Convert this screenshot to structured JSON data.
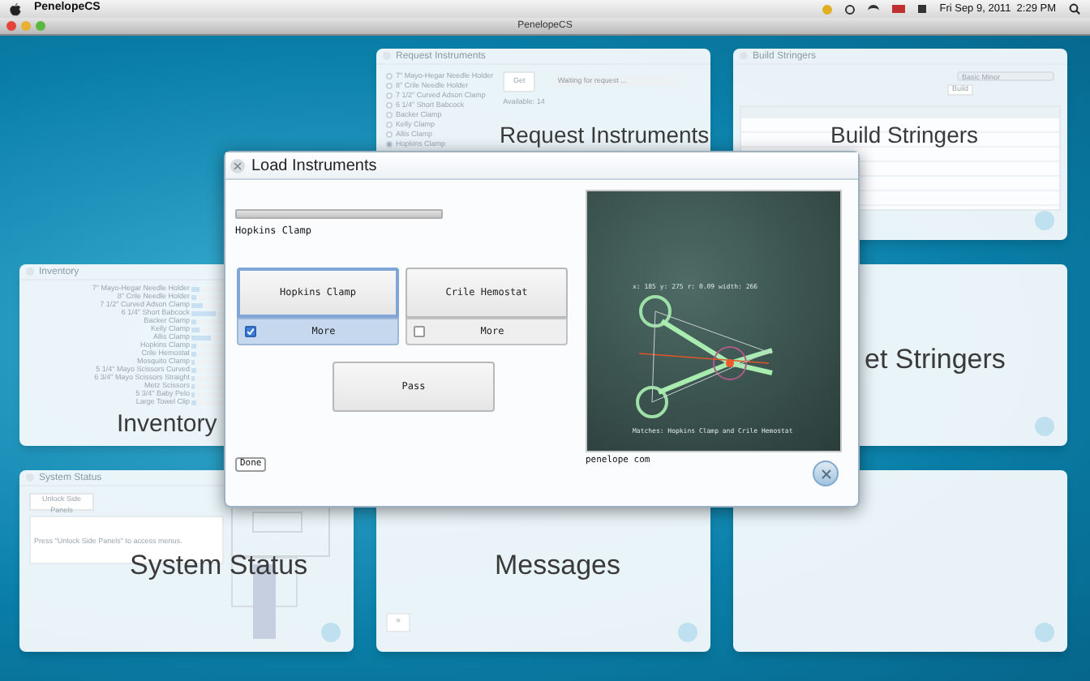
{
  "menu_bar": {
    "app_name": "PenelopeCS",
    "clock": "Fri Sep 9, 2011  2:29 PM"
  },
  "window": {
    "title": "PenelopeCS"
  },
  "panels": [
    {
      "kind": "empty"
    },
    {
      "kind": "request",
      "title": "Request Instruments",
      "label": "Request Instruments",
      "get_button": "Get",
      "available": "Available: 14",
      "placeholder": "Waiting for request ...",
      "items": [
        {
          "label": "7\" Mayo-Hegar Needle Holder",
          "selected": false
        },
        {
          "label": "8\" Crile Needle Holder",
          "selected": false
        },
        {
          "label": "7 1/2\" Curved Adson Clamp",
          "selected": false
        },
        {
          "label": "6 1/4\" Short Babcock",
          "selected": false
        },
        {
          "label": "Backer Clamp",
          "selected": false
        },
        {
          "label": "Kelly Clamp",
          "selected": false
        },
        {
          "label": "Allis Clamp",
          "selected": false
        },
        {
          "label": "Hopkins Clamp",
          "selected": true
        }
      ]
    },
    {
      "kind": "stringers",
      "title": "Build Stringers",
      "label": "Build Stringers",
      "select": "Basic Minor",
      "build_button": "Build"
    },
    {
      "kind": "inventory",
      "title": "Inventory",
      "label": "Inventory",
      "items": [
        {
          "label": "7\" Mayo-Hegar Needle Holder",
          "level": 0.15
        },
        {
          "label": "8\" Crile Needle Holder",
          "level": 0.1
        },
        {
          "label": "7 1/2\" Curved Adson Clamp",
          "level": 0.2
        },
        {
          "label": "6 1/4\" Short Babcock",
          "level": 0.45
        },
        {
          "label": "Backer Clamp",
          "level": 0.1
        },
        {
          "label": "Kelly Clamp",
          "level": 0.15
        },
        {
          "label": "Allis Clamp",
          "level": 0.35
        },
        {
          "label": "Hopkins Clamp",
          "level": 0.1
        },
        {
          "label": "Crile Hemostat",
          "level": 0.1
        },
        {
          "label": "Mosquito Clamp",
          "level": 0.05
        },
        {
          "label": "5 1/4\" Mayo Scissors Curved",
          "level": 0.1
        },
        {
          "label": "6 3/4\" Mayo Scissors Straight",
          "level": 0.05
        },
        {
          "label": "Metz Scissors",
          "level": 0.05
        },
        {
          "label": "5 3/4\" Baby Pelo",
          "level": 0.05
        },
        {
          "label": "Large Towel Clip",
          "level": 0.1
        }
      ]
    },
    {
      "kind": "empty"
    },
    {
      "kind": "get_stringers",
      "label": "et Stringers"
    },
    {
      "kind": "status",
      "title": "System Status",
      "label": "System Status",
      "unlock_button": "Unlock Side Panels",
      "message": "Press \"Unlock Side Panels\" to access menus."
    },
    {
      "kind": "messages",
      "label": "Messages",
      "next_button": "»"
    },
    {
      "kind": "blank"
    }
  ],
  "dialog": {
    "title": "Load Instruments",
    "progress": {
      "level": 1
    },
    "current": "Hopkins Clamp",
    "choices": [
      {
        "label": "Hopkins Clamp",
        "selected": true,
        "more": {
          "label": "More",
          "checked": true
        }
      },
      {
        "label": "Crile Hemostat",
        "selected": false,
        "more": {
          "label": "More",
          "checked": false
        }
      }
    ],
    "pass_button": "Pass",
    "done_button": "Done",
    "camera": {
      "readout": "x: 185  y: 275  r: 0.09  width: 266",
      "caption": "Matches: Hopkins Clamp and Crile Hemostat"
    },
    "footer": "penelope com"
  }
}
